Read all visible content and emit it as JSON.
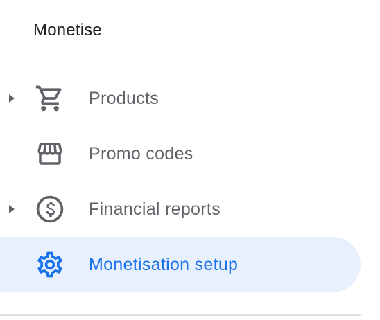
{
  "section": {
    "title": "Monetise"
  },
  "items": [
    {
      "label": "Products",
      "icon": "shopping-cart-icon",
      "expandable": true,
      "active": false
    },
    {
      "label": "Promo codes",
      "icon": "storefront-icon",
      "expandable": false,
      "active": false
    },
    {
      "label": "Financial reports",
      "icon": "dollar-circle-icon",
      "expandable": true,
      "active": false
    },
    {
      "label": "Monetisation setup",
      "icon": "gear-icon",
      "expandable": false,
      "active": true
    }
  ],
  "colors": {
    "text_default": "#5f6368",
    "text_active": "#1a73e8",
    "active_background": "#e8f0fe",
    "title": "#202124"
  }
}
